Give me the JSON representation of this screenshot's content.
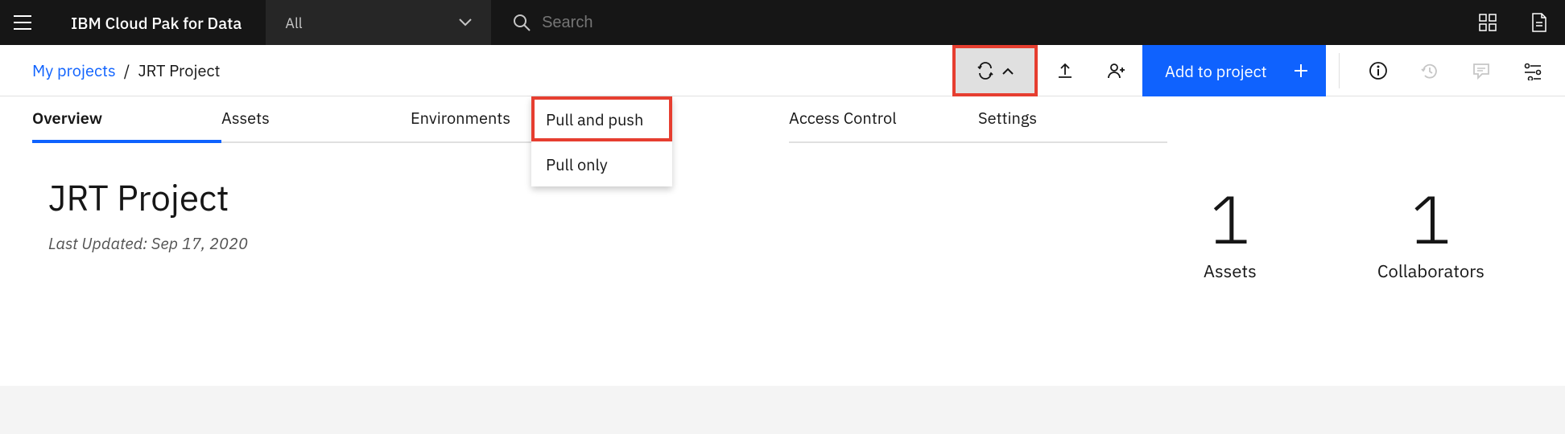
{
  "header": {
    "brand": "IBM Cloud Pak for Data",
    "filter_label": "All",
    "search_placeholder": "Search"
  },
  "breadcrumb": {
    "root": "My projects",
    "sep": "/",
    "current": "JRT Project"
  },
  "actions": {
    "add_to_project": "Add to project"
  },
  "sync_menu": {
    "items": [
      "Pull and push",
      "Pull only"
    ]
  },
  "tabs": [
    "Overview",
    "Assets",
    "Environments",
    "",
    "Access Control",
    "Settings"
  ],
  "project": {
    "title": "JRT Project",
    "last_updated_label": "Last Updated: Sep 17, 2020"
  },
  "stats": {
    "assets_count": "1",
    "assets_label": "Assets",
    "collab_count": "1",
    "collab_label": "Collaborators"
  }
}
